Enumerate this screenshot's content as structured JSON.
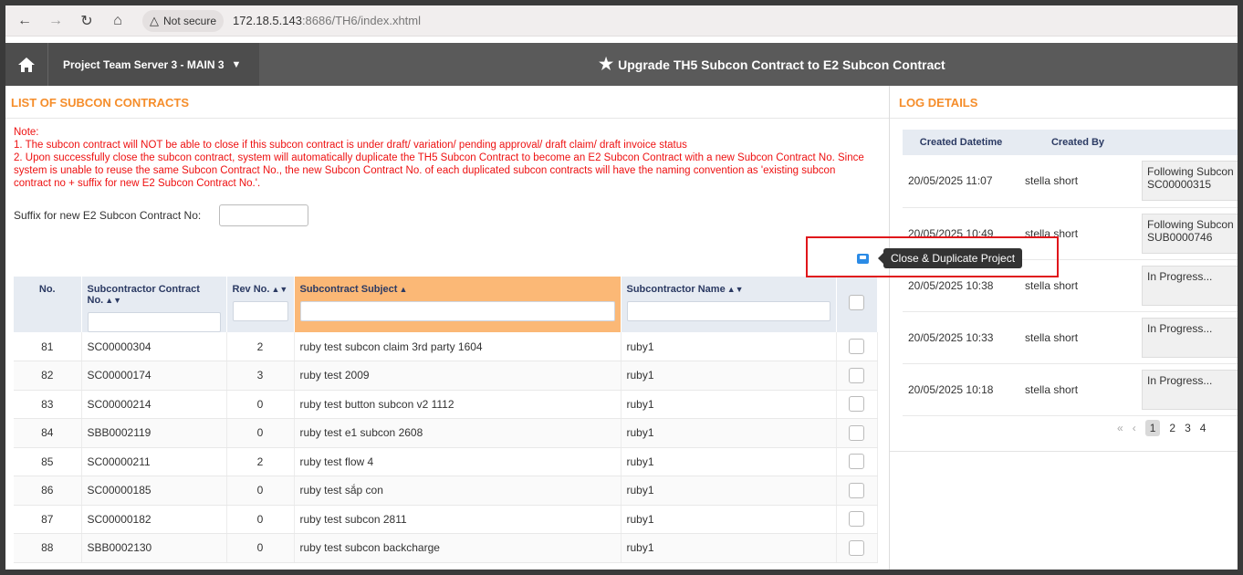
{
  "browser": {
    "security_label": "Not secure",
    "url_host": "172.18.5.143",
    "url_rest": ":8686/TH6/index.xhtml"
  },
  "header": {
    "server": "Project Team Server 3 - MAIN 3",
    "title": "Upgrade TH5 Subcon Contract to E2 Subcon Contract"
  },
  "list": {
    "title": "LIST OF SUBCON CONTRACTS",
    "note_label": "Note:",
    "note_1": "1. The subcon contract will NOT be able to close if this subcon contract is under draft/ variation/ pending approval/ draft claim/ draft invoice status",
    "note_2": "2. Upon successfully close the subcon contract, system will automatically duplicate the TH5 Subcon Contract to become an E2 Subcon Contract with a new Subcon Contract No. Since system is unable to reuse the same Subcon Contract No., the new Subcon Contract No. of each duplicated subcon contracts will have the naming convention as 'existing subcon contract no + suffix for new E2 Subcon Contract No.'.",
    "suffix_label": "Suffix for new E2 Subcon Contract No:",
    "tooltip": "Close & Duplicate Project",
    "columns": {
      "no": "No.",
      "contract_no": "Subcontractor Contract No.",
      "rev": "Rev No.",
      "subject": "Subcontract Subject",
      "name": "Subcontractor Name"
    },
    "rows": [
      {
        "no": "81",
        "contract": "SC00000304",
        "rev": "2",
        "subject": "ruby test subcon claim 3rd party 1604",
        "name": "ruby1"
      },
      {
        "no": "82",
        "contract": "SC00000174",
        "rev": "3",
        "subject": "ruby test 2009",
        "name": "ruby1"
      },
      {
        "no": "83",
        "contract": "SC00000214",
        "rev": "0",
        "subject": "ruby test button subcon v2 1112",
        "name": "ruby1"
      },
      {
        "no": "84",
        "contract": "SBB0002119",
        "rev": "0",
        "subject": "ruby test e1 subcon 2608",
        "name": "ruby1"
      },
      {
        "no": "85",
        "contract": "SC00000211",
        "rev": "2",
        "subject": "ruby test flow 4",
        "name": "ruby1"
      },
      {
        "no": "86",
        "contract": "SC00000185",
        "rev": "0",
        "subject": "ruby test sắp con",
        "name": "ruby1"
      },
      {
        "no": "87",
        "contract": "SC00000182",
        "rev": "0",
        "subject": "ruby test subcon 2811",
        "name": "ruby1"
      },
      {
        "no": "88",
        "contract": "SBB0002130",
        "rev": "0",
        "subject": "ruby test subcon backcharge",
        "name": "ruby1"
      }
    ]
  },
  "log": {
    "title": "LOG DETAILS",
    "columns": {
      "datetime": "Created Datetime",
      "by": "Created By"
    },
    "rows": [
      {
        "datetime": "20/05/2025 11:07",
        "by": "stella short",
        "remark1": "Following Subcon",
        "remark2": "SC00000315"
      },
      {
        "datetime": "20/05/2025 10:49",
        "by": "stella short",
        "remark1": "Following Subcon",
        "remark2": "SUB0000746"
      },
      {
        "datetime": "20/05/2025 10:38",
        "by": "stella short",
        "remark1": "In Progress...",
        "remark2": ""
      },
      {
        "datetime": "20/05/2025 10:33",
        "by": "stella short",
        "remark1": "In Progress...",
        "remark2": ""
      },
      {
        "datetime": "20/05/2025 10:18",
        "by": "stella short",
        "remark1": "In Progress...",
        "remark2": ""
      }
    ],
    "pages": [
      "1",
      "2",
      "3",
      "4"
    ]
  }
}
